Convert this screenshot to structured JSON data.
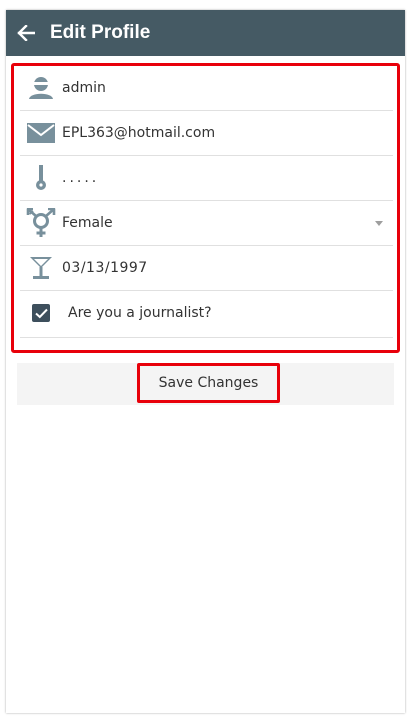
{
  "appbar": {
    "title": "Edit Profile",
    "back_icon": "arrow-left-icon",
    "background": "#455a64"
  },
  "form": {
    "username": {
      "icon": "user-icon",
      "value": "admin"
    },
    "email": {
      "icon": "envelope-icon",
      "value": "EPL363@hotmail.com"
    },
    "password": {
      "icon": "key-icon",
      "value": "....."
    },
    "gender": {
      "icon": "gender-icon",
      "selected": "Female"
    },
    "birthdate": {
      "icon": "cocktail-glass-icon",
      "value": "03/13/1997"
    },
    "journalist": {
      "label": "Are you a journalist?",
      "checked": true
    }
  },
  "actions": {
    "save_label": "Save Changes"
  },
  "colors": {
    "highlight": "#e8000a",
    "icon": "#78909c"
  }
}
